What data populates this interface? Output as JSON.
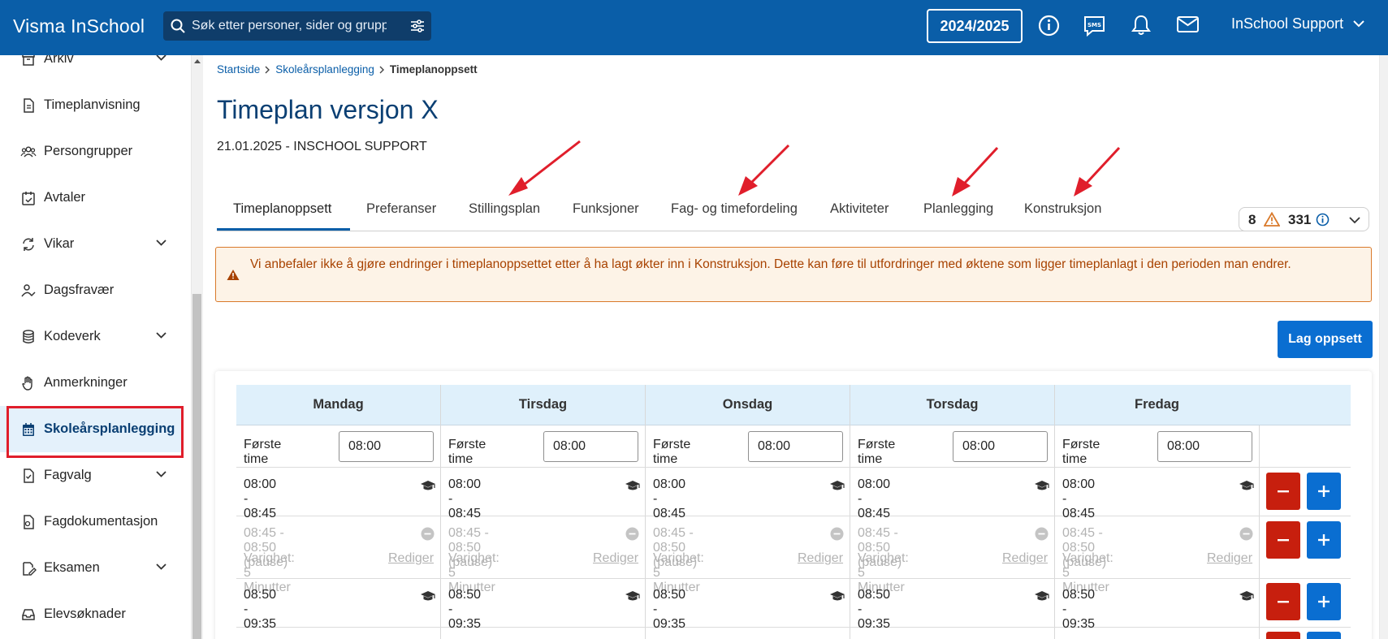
{
  "topbar": {
    "brand": "Visma InSchool",
    "search_placeholder": "Søk etter personer, sider og grupper",
    "year": "2024/2025",
    "user": "InSchool Support",
    "icons": [
      "search-icon",
      "filter-icon",
      "info-icon",
      "sms-icon",
      "bell-icon",
      "mail-icon",
      "chevron-down-icon"
    ]
  },
  "sidebar": {
    "items": [
      {
        "label": "Arkiv",
        "icon": "archive-icon",
        "expandable": true
      },
      {
        "label": "Timeplanvisning",
        "icon": "document-icon",
        "expandable": false
      },
      {
        "label": "Persongrupper",
        "icon": "people-icon",
        "expandable": false
      },
      {
        "label": "Avtaler",
        "icon": "calendar-check-icon",
        "expandable": false
      },
      {
        "label": "Vikar",
        "icon": "swap-icon",
        "expandable": true
      },
      {
        "label": "Dagsfravær",
        "icon": "person-check-icon",
        "expandable": false
      },
      {
        "label": "Kodeverk",
        "icon": "database-icon",
        "expandable": true
      },
      {
        "label": "Anmerkninger",
        "icon": "hand-icon",
        "expandable": false
      },
      {
        "label": "Skoleårsplanlegging",
        "icon": "calendar-icon",
        "expandable": false,
        "active": true
      },
      {
        "label": "Fagvalg",
        "icon": "document-icon",
        "expandable": true
      },
      {
        "label": "Fagdokumentasjon",
        "icon": "document-icon",
        "expandable": false
      },
      {
        "label": "Eksamen",
        "icon": "edit-icon",
        "expandable": true
      },
      {
        "label": "Elevsøknader",
        "icon": "inbox-icon",
        "expandable": false
      }
    ]
  },
  "breadcrumb": {
    "items": [
      "Startside",
      "Skoleårsplanlegging"
    ],
    "current": "Timeplanoppsett"
  },
  "page": {
    "title": "Timeplan versjon X",
    "subtitle": "21.01.2025 - INSCHOOL SUPPORT"
  },
  "tabs": [
    "Timeplanoppsett",
    "Preferanser",
    "Stillingsplan",
    "Funksjoner",
    "Fag- og timefordeling",
    "Aktiviteter",
    "Planlegging",
    "Konstruksjon"
  ],
  "active_tab": "Timeplanoppsett",
  "counter": {
    "warnings": "8",
    "infos": "331"
  },
  "warning": {
    "text": "Vi anbefaler ikke å gjøre endringer i timeplanoppsettet etter å ha lagt økter inn i Konstruksjon. Dette kan føre til utfordringer med øktene som ligger timeplanlagt i den perioden man endrer."
  },
  "lag_button": "Lag oppsett",
  "schedule": {
    "days": [
      "Mandag",
      "Tirsdag",
      "Onsdag",
      "Torsdag",
      "Fredag"
    ],
    "first_label": "Første time",
    "first_value": "08:00",
    "rows": [
      {
        "time": "08:00 - 08:45",
        "type": "lesson"
      },
      {
        "time": "08:45 - 08:50 (pause)",
        "type": "pause",
        "duration": "Varighet: 5 Minutter",
        "edit": "Rediger"
      },
      {
        "time": "08:50 - 09:35",
        "type": "lesson"
      }
    ]
  },
  "colors": {
    "topbar": "#0a5ea8",
    "accent": "#0a6ed1",
    "title": "#0a3f73",
    "danger": "#c71f0e",
    "annotation_red": "#e01e2b",
    "warning_bg": "#fdf3e7",
    "warning_text": "#a84200"
  }
}
